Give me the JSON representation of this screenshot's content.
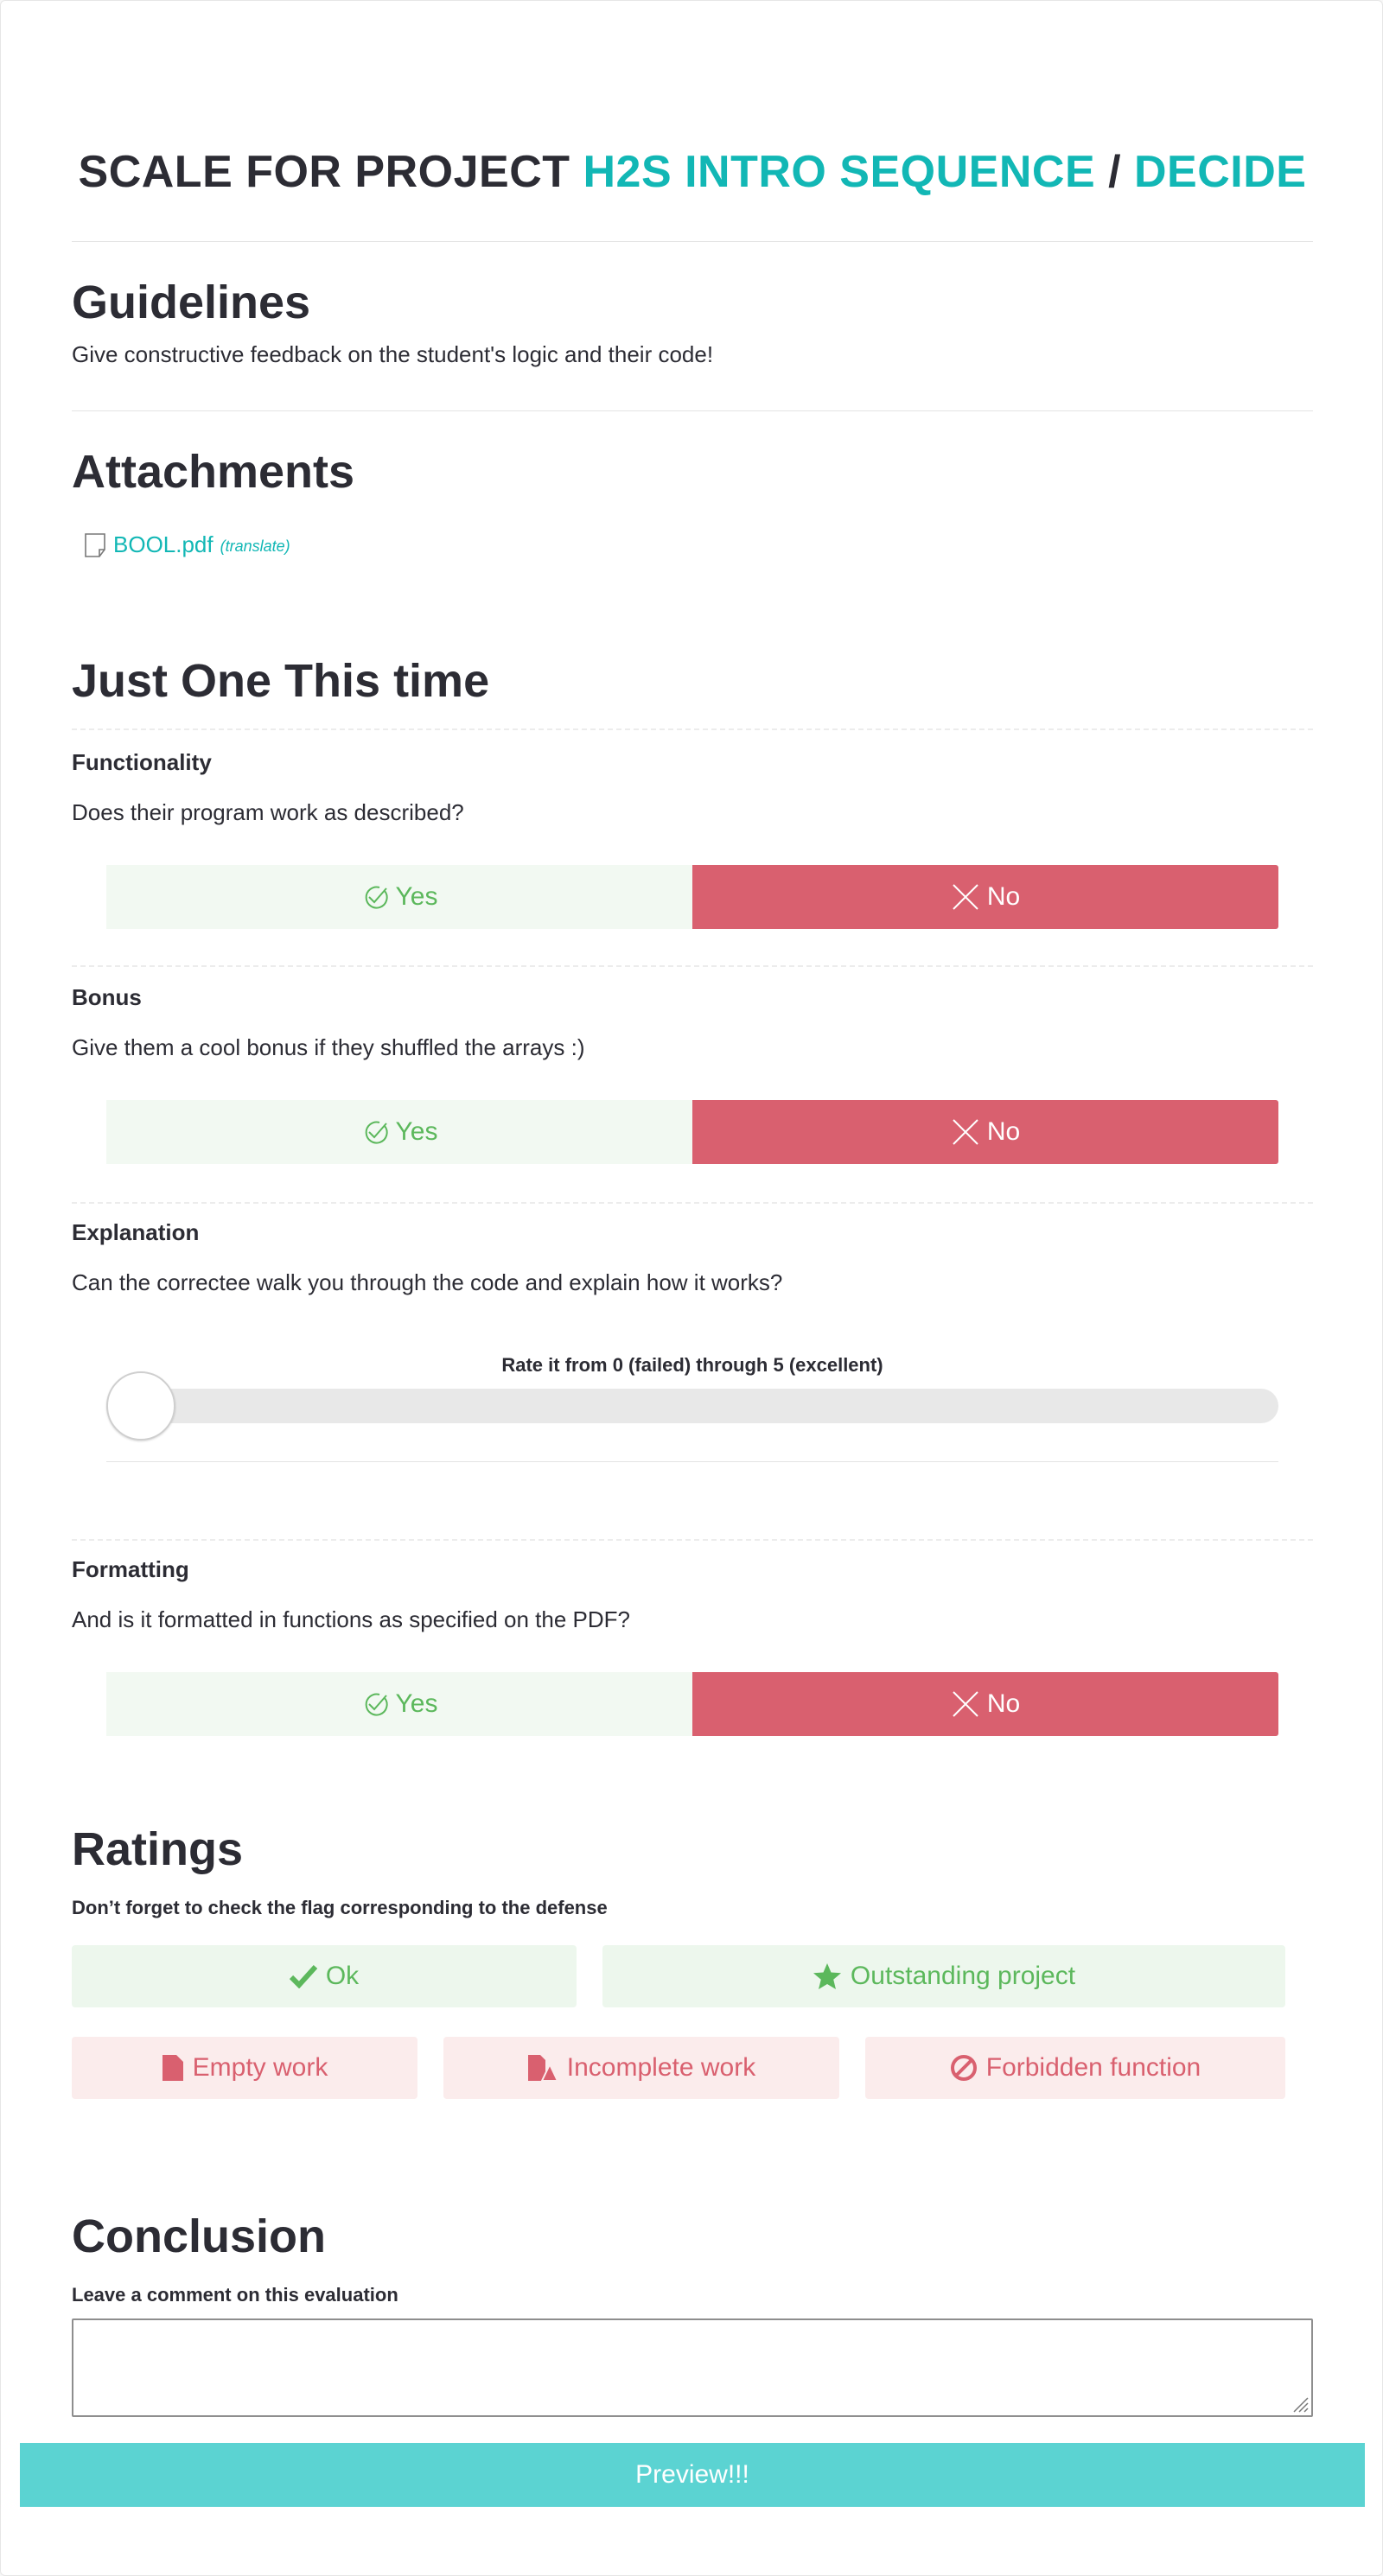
{
  "header": {
    "prefix": "SCALE FOR PROJECT",
    "project": "H2S INTRO SEQUENCE",
    "separator": "/",
    "subproject": "DECIDE"
  },
  "guidelines": {
    "title": "Guidelines",
    "text": "Give constructive feedback on the student's logic and their code!"
  },
  "attachments": {
    "title": "Attachments",
    "file_name": "BOOL.pdf",
    "translate_label": "(translate)",
    "icon": "document-icon"
  },
  "section": {
    "title": "Just One This time",
    "questions": [
      {
        "name": "Functionality",
        "description": "Does their program work as described?",
        "yes_label": "Yes",
        "no_label": "No",
        "selected": "No"
      },
      {
        "name": "Bonus",
        "description": "Give them a cool bonus if they shuffled the arrays :)",
        "yes_label": "Yes",
        "no_label": "No",
        "selected": "No"
      },
      {
        "name": "Explanation",
        "description": "Can the correctee walk you through the code and explain how it works?",
        "rate_label": "Rate it from 0 (failed) through 5 (excellent)",
        "rating": 0,
        "rating_max": 5
      },
      {
        "name": "Formatting",
        "description": "And is it formatted in functions as specified on the PDF?",
        "yes_label": "Yes",
        "no_label": "No",
        "selected": "No"
      }
    ]
  },
  "ratings": {
    "title": "Ratings",
    "hint": "Don’t forget to check the flag corresponding to the defense",
    "flags": {
      "ok": {
        "label": "Ok",
        "icon": "checkmark-icon"
      },
      "outstanding": {
        "label": "Outstanding project",
        "icon": "star-icon"
      },
      "empty": {
        "label": "Empty work",
        "icon": "file-icon"
      },
      "incomplete": {
        "label": "Incomplete work",
        "icon": "file-warning-icon"
      },
      "forbidden": {
        "label": "Forbidden function",
        "icon": "ban-icon"
      }
    }
  },
  "conclusion": {
    "title": "Conclusion",
    "hint": "Leave a comment on this evaluation",
    "comment_value": ""
  },
  "preview_label": "Preview!!!",
  "colors": {
    "accent": "#12b7b5",
    "yes_bg": "#f2f9f2",
    "yes_text": "#5cb85c",
    "no_bg": "#d9606f",
    "preview_bg": "#5bd3d2"
  }
}
